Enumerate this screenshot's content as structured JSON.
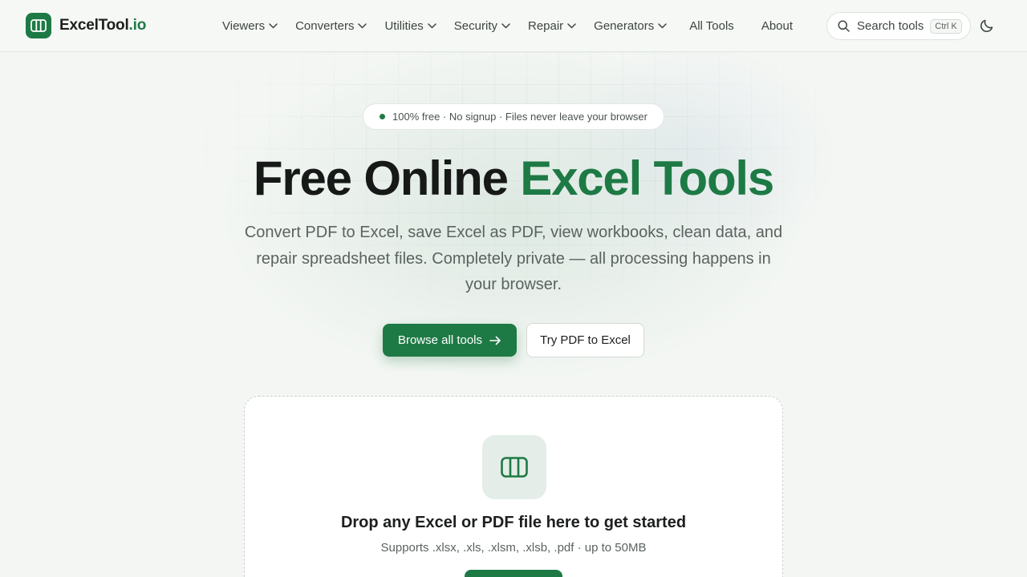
{
  "brand": {
    "name": "ExcelTool",
    "tld": ".io",
    "accent_color": "#1e7a45"
  },
  "nav": {
    "items": [
      {
        "label": "Viewers",
        "dropdown": true
      },
      {
        "label": "Converters",
        "dropdown": true
      },
      {
        "label": "Utilities",
        "dropdown": true
      },
      {
        "label": "Security",
        "dropdown": true
      },
      {
        "label": "Repair",
        "dropdown": true
      },
      {
        "label": "Generators",
        "dropdown": true
      },
      {
        "label": "All Tools",
        "dropdown": false
      },
      {
        "label": "About",
        "dropdown": false
      }
    ]
  },
  "search": {
    "label": "Search tools",
    "shortcut": "Ctrl K",
    "icon": "search-icon"
  },
  "theme_toggle": {
    "icon": "moon-icon"
  },
  "hero": {
    "badge": "100% free · No signup · Files never leave your browser",
    "title_main": "Free Online ",
    "title_accent": "Excel Tools",
    "subtitle": "Convert PDF to Excel, save Excel as PDF, view workbooks, clean data, and repair spreadsheet files. Completely private — all processing happens in your browser.",
    "primary_cta": "Browse all tools",
    "secondary_cta": "Try PDF to Excel"
  },
  "dropzone": {
    "icon": "spreadsheet-columns-icon",
    "title": "Drop any Excel or PDF file here to get started",
    "subtitle": "Supports .xlsx, .xls, .xlsm, .xlsb, .pdf · up to 50MB"
  }
}
